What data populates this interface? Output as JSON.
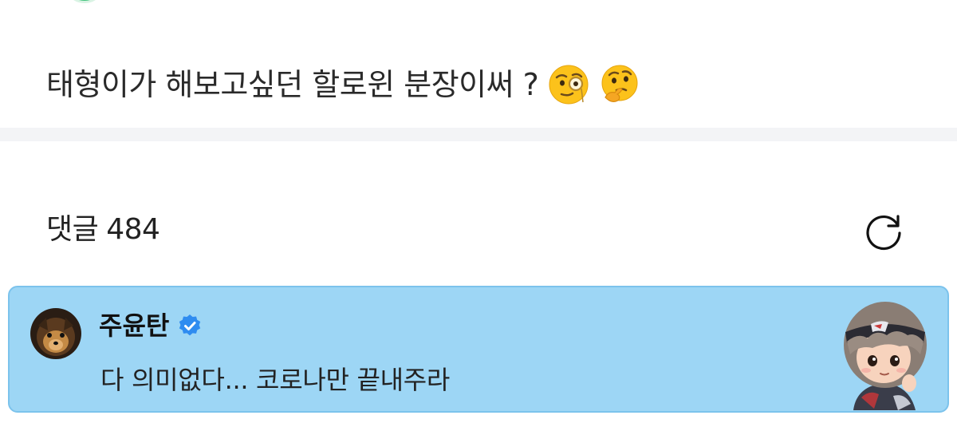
{
  "post": {
    "text": "태형이가 해보고싶던 할로윈 분장이써 ?",
    "emojis": [
      "face-with-monocle",
      "thinking-face"
    ]
  },
  "comments": {
    "label": "댓글",
    "count": "484",
    "refresh_icon": "refresh-icon"
  },
  "highlight_comment": {
    "author": "주윤탄",
    "verified": true,
    "text": "다 의미없다... 코로나만 끝내주라",
    "background": "#9dd6f5",
    "sticker": "character-sticker"
  },
  "colors": {
    "card_background": "#9dd6f5",
    "card_border": "#7cc3ec",
    "verified_badge": "#2f8cf0",
    "divider": "#f3f4f6"
  }
}
